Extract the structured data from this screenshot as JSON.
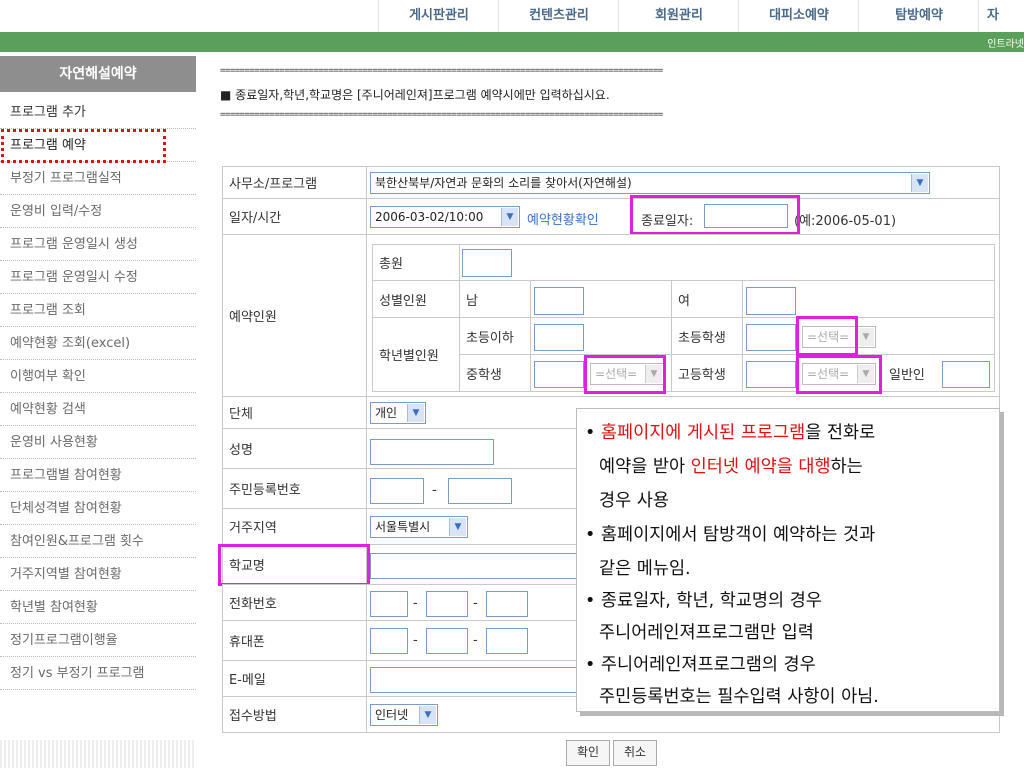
{
  "topnav": {
    "tabs": [
      "게시판관리",
      "컨텐츠관리",
      "회원관리",
      "대피소예약",
      "탐방예약",
      "자"
    ],
    "right_link": "인트라넷"
  },
  "sidebar": {
    "header": "자연해설예약",
    "items": [
      "프로그램 추가",
      "프로그램 예약",
      "부정기 프로그램실적",
      "운영비 입력/수정",
      "프로그램 운영일시 생성",
      "프로그램 운영일시 수정",
      "프로그램 조회",
      "예약현황 조회(excel)",
      "이행여부 확인",
      "예약현황 검색",
      "운영비 사용현황",
      "프로그램별 참여현황",
      "단체성격별 참여현황",
      "참여인원&프로그램 횟수",
      "거주지역별 참여현황",
      "학년별 참여현황",
      "정기프로그램이행율",
      "정기 vs 부정기 프로그램"
    ]
  },
  "notice": {
    "line": "==========================================================================================",
    "text": "■ 종료일자,학년,학교명은 [주니어레인져]프로그램 예약시에만 입력하십시요."
  },
  "form": {
    "office_label": "사무소/프로그램",
    "office_value": "북한산북부/자연과 문화의 소리를 찾아서(자연해설)",
    "datetime_label": "일자/시간",
    "datetime_value": "2006-03-02/10:00",
    "status_link": "예약현황확인",
    "end_date_label": "종료일자:",
    "end_date_example": "(예:2006-05-01)",
    "people_label": "예약인원",
    "total_label": "총원",
    "gender_label": "성별인원",
    "male_label": "남",
    "female_label": "여",
    "grade_label": "학년별인원",
    "preschool_label": "초등이하",
    "elementary_label": "초등학생",
    "middle_label": "중학생",
    "high_label": "고등학생",
    "adult_label": "일반인",
    "grade_select": "=선택=",
    "group_label": "단체",
    "group_value": "개인",
    "name_label": "성명",
    "ssn_label": "주민등록번호",
    "ssn_sep": "-",
    "region_label": "거주지역",
    "region_value": "서울특별시",
    "school_label": "학교명",
    "phone_label": "전화번호",
    "mobile_label": "휴대폰",
    "email_label": "E-메일",
    "method_label": "접수방법",
    "method_value": "인터넷",
    "confirm_button": "확인",
    "cancel_button": "취소"
  },
  "callout": {
    "b1_pre": "• ",
    "b1_red1": "홈페이지에 게시된 프로그램",
    "b1_mid": "을 전화로",
    "b1_l2_pre": "예약을 받아 ",
    "b1_red2": "인터넷 예약을 대행",
    "b1_l2_post": "하는",
    "b1_l3": "경우 사용",
    "b2_l1": "• 홈페이지에서 탐방객이 예약하는 것과",
    "b2_l2": "같은 메뉴임.",
    "b3_l1": "• 종료일자, 학년, 학교명의 경우",
    "b3_l2": "주니어레인져프로그램만 입력",
    "b4_l1": "• 주니어레인져프로그램의 경우",
    "b4_l2": "주민등록번호는 필수입력 사항이 아님."
  }
}
